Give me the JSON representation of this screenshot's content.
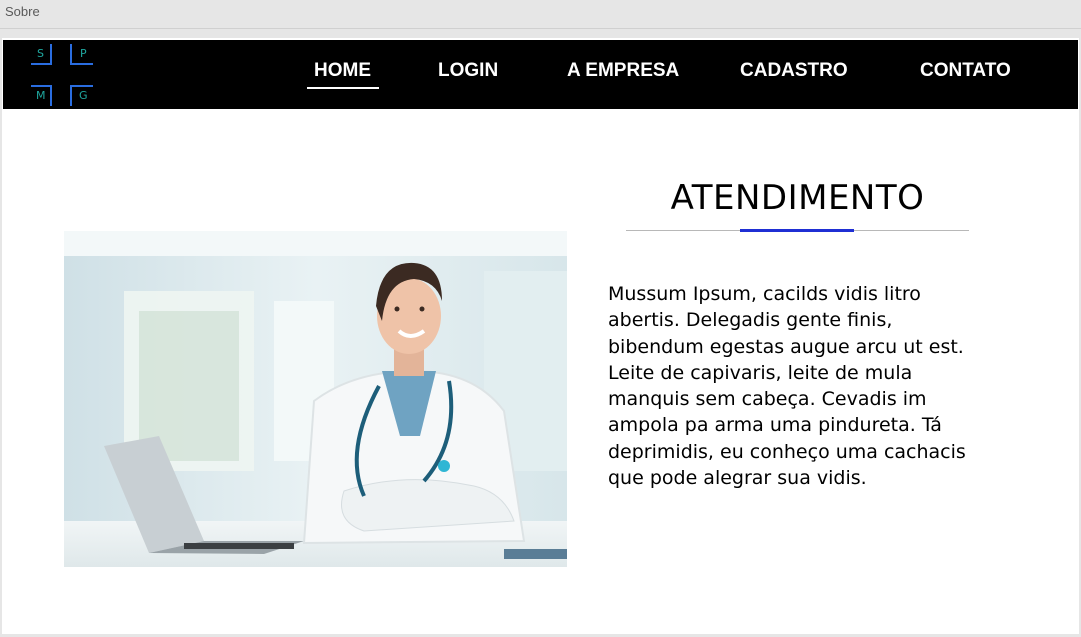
{
  "window": {
    "title": "Sobre"
  },
  "logo": {
    "letters": [
      "S",
      "P",
      "M",
      "G"
    ],
    "color": "#2a6de0",
    "letter_color": "#1fa8a0"
  },
  "nav": {
    "items": [
      "HOME",
      "LOGIN",
      "A EMPRESA",
      "CADASTRO",
      "CONTATO"
    ],
    "active": "HOME"
  },
  "section": {
    "title": "ATENDIMENTO",
    "accent_color": "#1f2fd4",
    "paragraph": "Mussum Ipsum, cacilds vidis litro abertis. Delegadis gente finis, bibendum egestas augue arcu ut est. Leite de capivaris, leite de mula manquis sem cabeça. Cevadis im ampola pa arma uma pindureta. Tá deprimidis, eu conheço uma cachacis que pode alegrar sua vidis."
  },
  "image": {
    "subject": "smiling female doctor with stethoscope at desk with laptop"
  }
}
